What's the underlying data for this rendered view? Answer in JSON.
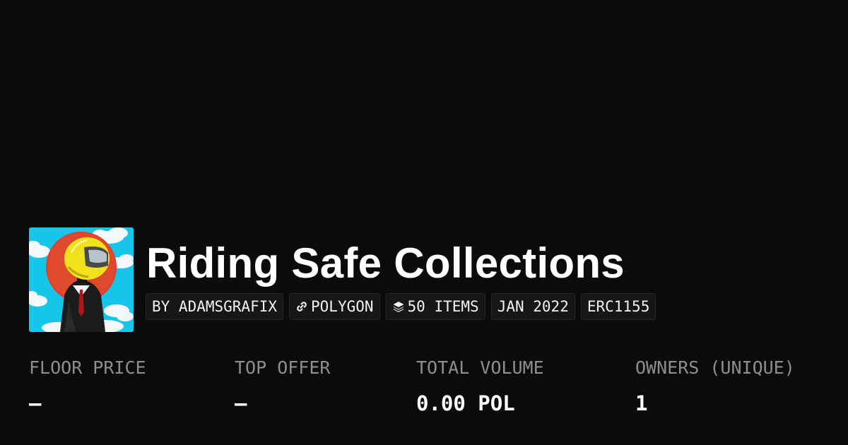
{
  "collection": {
    "title": "Riding Safe Collections",
    "avatar_icon": "helmet-rider-artwork"
  },
  "tags": {
    "creator": "BY ADAMSGRAFIX",
    "chain": "POLYGON",
    "chain_icon": "link-icon",
    "items": "50 ITEMS",
    "items_icon": "layers-icon",
    "date": "JAN 2022",
    "standard": "ERC1155"
  },
  "stats": {
    "floor_label": "FLOOR PRICE",
    "floor_value": "–",
    "offer_label": "TOP OFFER",
    "offer_value": "–",
    "volume_label": "TOTAL VOLUME",
    "volume_value": "0.00 POL",
    "owners_label": "OWNERS (UNIQUE)",
    "owners_value": "1"
  },
  "colors": {
    "background": "#0b0b0b",
    "pill_bg": "#161616",
    "label": "#8e8e8e",
    "avatar_sky": "#16c6e8",
    "avatar_sun": "#e8392b",
    "helmet": "#f2e21c"
  }
}
